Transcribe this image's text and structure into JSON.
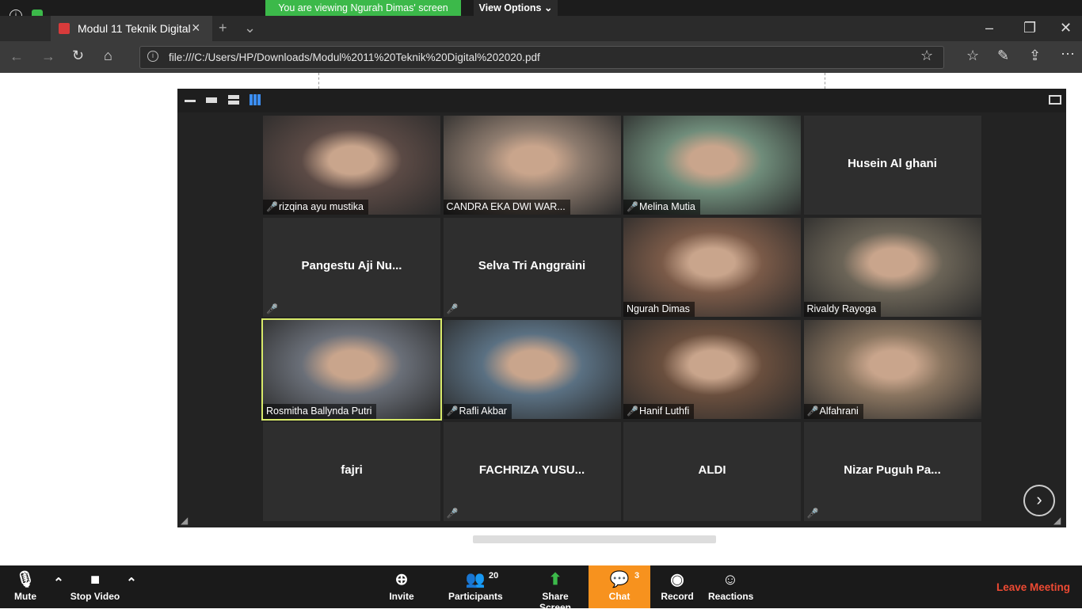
{
  "banner": {
    "viewing": "You are viewing Ngurah Dimas' screen",
    "view_options": "View Options"
  },
  "browser": {
    "tab_title": "Modul 11 Teknik Digital",
    "url": "file:///C:/Users/HP/Downloads/Modul%2011%20Teknik%20Digital%202020.pdf"
  },
  "participants": [
    {
      "name": "rizqina ayu mustika",
      "muted": true,
      "video": true,
      "color": "#5b4a45"
    },
    {
      "name": "CANDRA EKA DWI WAR...",
      "muted": false,
      "video": true,
      "color": "#8d7b6e"
    },
    {
      "name": "Melina Mutia",
      "muted": true,
      "video": true,
      "color": "#6f8c7a"
    },
    {
      "name": "Husein Al ghani",
      "muted": false,
      "video": false
    },
    {
      "name": "Pangestu Aji Nu...",
      "muted": true,
      "video": false
    },
    {
      "name": "Selva Tri Anggraini",
      "muted": true,
      "video": false
    },
    {
      "name": "Ngurah Dimas",
      "muted": false,
      "video": true,
      "color": "#7a5a48"
    },
    {
      "name": "Rivaldy Rayoga",
      "muted": false,
      "video": true,
      "color": "#6b6457"
    },
    {
      "name": "Rosmitha Ballynda Putri",
      "muted": false,
      "video": true,
      "color": "#6a6f78"
    },
    {
      "name": "Rafli Akbar",
      "muted": true,
      "video": true,
      "color": "#5a7082"
    },
    {
      "name": "Hanif Luthfi",
      "muted": true,
      "video": true,
      "color": "#6a4f3e"
    },
    {
      "name": "Alfahrani",
      "muted": true,
      "video": true,
      "color": "#8a7560"
    },
    {
      "name": "fajri",
      "muted": false,
      "video": false
    },
    {
      "name": "FACHRIZA YUSU...",
      "muted": true,
      "video": false
    },
    {
      "name": "ALDI",
      "muted": false,
      "video": false
    },
    {
      "name": "Nizar Puguh Pa...",
      "muted": true,
      "video": false
    }
  ],
  "toolbar": {
    "mute": "Mute",
    "stop_video": "Stop Video",
    "invite": "Invite",
    "participants": "Participants",
    "participants_count": "20",
    "share_screen": "Share Screen",
    "chat": "Chat",
    "chat_count": "3",
    "record": "Record",
    "reactions": "Reactions",
    "leave": "Leave Meeting"
  }
}
